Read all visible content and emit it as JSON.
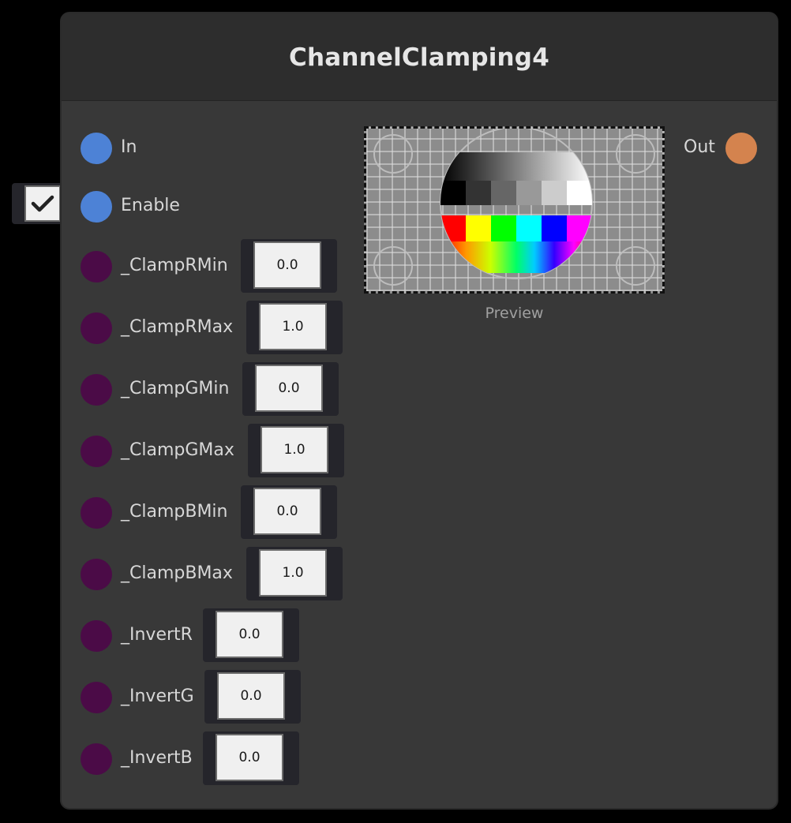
{
  "node": {
    "title": "ChannelClamping4"
  },
  "inputs": [
    {
      "label": "In",
      "color": "#4d82d6",
      "kind": "port"
    },
    {
      "label": "Enable",
      "color": "#4d82d6",
      "kind": "checkbox",
      "checked": true
    },
    {
      "label": "_ClampRMin",
      "color": "#4b0b47",
      "value": "0.0"
    },
    {
      "label": "_ClampRMax",
      "color": "#4b0b47",
      "value": "1.0"
    },
    {
      "label": "_ClampGMin",
      "color": "#4b0b47",
      "value": "0.0"
    },
    {
      "label": "_ClampGMax",
      "color": "#4b0b47",
      "value": "1.0"
    },
    {
      "label": "_ClampBMin",
      "color": "#4b0b47",
      "value": "0.0"
    },
    {
      "label": "_ClampBMax",
      "color": "#4b0b47",
      "value": "1.0"
    },
    {
      "label": "_InvertR",
      "color": "#4b0b47",
      "value": "0.0"
    },
    {
      "label": "_InvertG",
      "color": "#4b0b47",
      "value": "0.0"
    },
    {
      "label": "_InvertB",
      "color": "#4b0b47",
      "value": "0.0"
    }
  ],
  "output": {
    "label": "Out",
    "color": "#d4834e"
  },
  "preview": {
    "label": "Preview"
  }
}
